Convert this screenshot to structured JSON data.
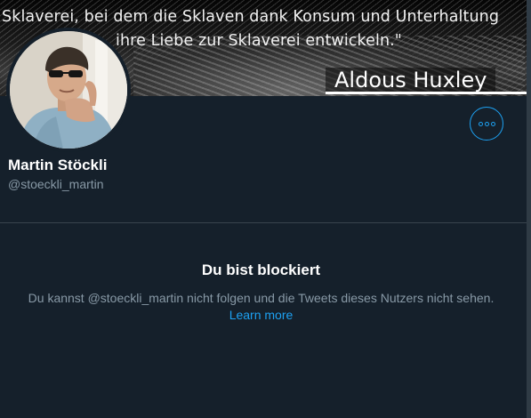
{
  "banner": {
    "quote_line_1": "Sklaverei, bei dem die Sklaven dank Konsum und Unterhaltung",
    "quote_line_2": "ihre Liebe zur Sklaverei entwickeln.\"",
    "author": "Aldous Huxley"
  },
  "profile": {
    "display_name": "Martin Stöckli",
    "handle": "@stoeckli_martin",
    "more_button_icon": "more-horizontal-icon"
  },
  "blocked": {
    "title": "Du bist blockiert",
    "message": "Du kannst @stoeckli_martin nicht folgen und die Tweets dieses Nutzers nicht sehen.",
    "learn_more": "Learn more"
  },
  "colors": {
    "background": "#15202b",
    "accent": "#1da1f2",
    "secondary_text": "#8899a6",
    "divider": "#38444d"
  }
}
